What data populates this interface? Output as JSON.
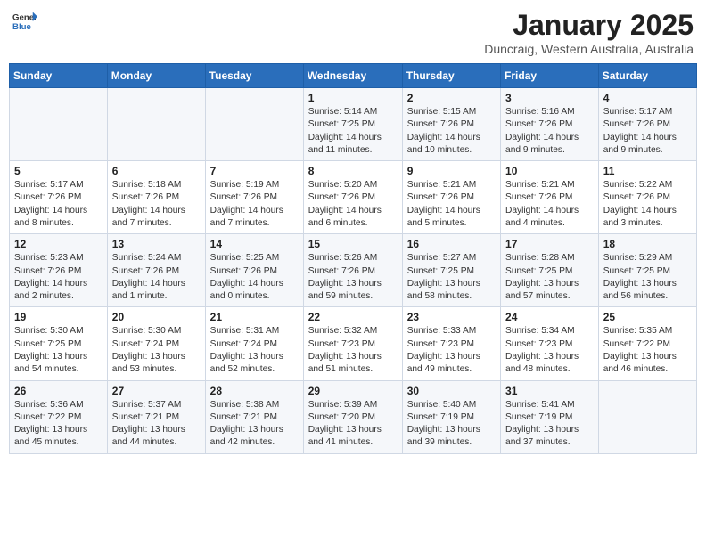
{
  "header": {
    "logo_line1": "General",
    "logo_line2": "Blue",
    "title": "January 2025",
    "subtitle": "Duncraig, Western Australia, Australia"
  },
  "days_of_week": [
    "Sunday",
    "Monday",
    "Tuesday",
    "Wednesday",
    "Thursday",
    "Friday",
    "Saturday"
  ],
  "weeks": [
    [
      {
        "day": "",
        "info": ""
      },
      {
        "day": "",
        "info": ""
      },
      {
        "day": "",
        "info": ""
      },
      {
        "day": "1",
        "info": "Sunrise: 5:14 AM\nSunset: 7:25 PM\nDaylight: 14 hours\nand 11 minutes."
      },
      {
        "day": "2",
        "info": "Sunrise: 5:15 AM\nSunset: 7:26 PM\nDaylight: 14 hours\nand 10 minutes."
      },
      {
        "day": "3",
        "info": "Sunrise: 5:16 AM\nSunset: 7:26 PM\nDaylight: 14 hours\nand 9 minutes."
      },
      {
        "day": "4",
        "info": "Sunrise: 5:17 AM\nSunset: 7:26 PM\nDaylight: 14 hours\nand 9 minutes."
      }
    ],
    [
      {
        "day": "5",
        "info": "Sunrise: 5:17 AM\nSunset: 7:26 PM\nDaylight: 14 hours\nand 8 minutes."
      },
      {
        "day": "6",
        "info": "Sunrise: 5:18 AM\nSunset: 7:26 PM\nDaylight: 14 hours\nand 7 minutes."
      },
      {
        "day": "7",
        "info": "Sunrise: 5:19 AM\nSunset: 7:26 PM\nDaylight: 14 hours\nand 7 minutes."
      },
      {
        "day": "8",
        "info": "Sunrise: 5:20 AM\nSunset: 7:26 PM\nDaylight: 14 hours\nand 6 minutes."
      },
      {
        "day": "9",
        "info": "Sunrise: 5:21 AM\nSunset: 7:26 PM\nDaylight: 14 hours\nand 5 minutes."
      },
      {
        "day": "10",
        "info": "Sunrise: 5:21 AM\nSunset: 7:26 PM\nDaylight: 14 hours\nand 4 minutes."
      },
      {
        "day": "11",
        "info": "Sunrise: 5:22 AM\nSunset: 7:26 PM\nDaylight: 14 hours\nand 3 minutes."
      }
    ],
    [
      {
        "day": "12",
        "info": "Sunrise: 5:23 AM\nSunset: 7:26 PM\nDaylight: 14 hours\nand 2 minutes."
      },
      {
        "day": "13",
        "info": "Sunrise: 5:24 AM\nSunset: 7:26 PM\nDaylight: 14 hours\nand 1 minute."
      },
      {
        "day": "14",
        "info": "Sunrise: 5:25 AM\nSunset: 7:26 PM\nDaylight: 14 hours\nand 0 minutes."
      },
      {
        "day": "15",
        "info": "Sunrise: 5:26 AM\nSunset: 7:26 PM\nDaylight: 13 hours\nand 59 minutes."
      },
      {
        "day": "16",
        "info": "Sunrise: 5:27 AM\nSunset: 7:25 PM\nDaylight: 13 hours\nand 58 minutes."
      },
      {
        "day": "17",
        "info": "Sunrise: 5:28 AM\nSunset: 7:25 PM\nDaylight: 13 hours\nand 57 minutes."
      },
      {
        "day": "18",
        "info": "Sunrise: 5:29 AM\nSunset: 7:25 PM\nDaylight: 13 hours\nand 56 minutes."
      }
    ],
    [
      {
        "day": "19",
        "info": "Sunrise: 5:30 AM\nSunset: 7:25 PM\nDaylight: 13 hours\nand 54 minutes."
      },
      {
        "day": "20",
        "info": "Sunrise: 5:30 AM\nSunset: 7:24 PM\nDaylight: 13 hours\nand 53 minutes."
      },
      {
        "day": "21",
        "info": "Sunrise: 5:31 AM\nSunset: 7:24 PM\nDaylight: 13 hours\nand 52 minutes."
      },
      {
        "day": "22",
        "info": "Sunrise: 5:32 AM\nSunset: 7:23 PM\nDaylight: 13 hours\nand 51 minutes."
      },
      {
        "day": "23",
        "info": "Sunrise: 5:33 AM\nSunset: 7:23 PM\nDaylight: 13 hours\nand 49 minutes."
      },
      {
        "day": "24",
        "info": "Sunrise: 5:34 AM\nSunset: 7:23 PM\nDaylight: 13 hours\nand 48 minutes."
      },
      {
        "day": "25",
        "info": "Sunrise: 5:35 AM\nSunset: 7:22 PM\nDaylight: 13 hours\nand 46 minutes."
      }
    ],
    [
      {
        "day": "26",
        "info": "Sunrise: 5:36 AM\nSunset: 7:22 PM\nDaylight: 13 hours\nand 45 minutes."
      },
      {
        "day": "27",
        "info": "Sunrise: 5:37 AM\nSunset: 7:21 PM\nDaylight: 13 hours\nand 44 minutes."
      },
      {
        "day": "28",
        "info": "Sunrise: 5:38 AM\nSunset: 7:21 PM\nDaylight: 13 hours\nand 42 minutes."
      },
      {
        "day": "29",
        "info": "Sunrise: 5:39 AM\nSunset: 7:20 PM\nDaylight: 13 hours\nand 41 minutes."
      },
      {
        "day": "30",
        "info": "Sunrise: 5:40 AM\nSunset: 7:19 PM\nDaylight: 13 hours\nand 39 minutes."
      },
      {
        "day": "31",
        "info": "Sunrise: 5:41 AM\nSunset: 7:19 PM\nDaylight: 13 hours\nand 37 minutes."
      },
      {
        "day": "",
        "info": ""
      }
    ]
  ]
}
